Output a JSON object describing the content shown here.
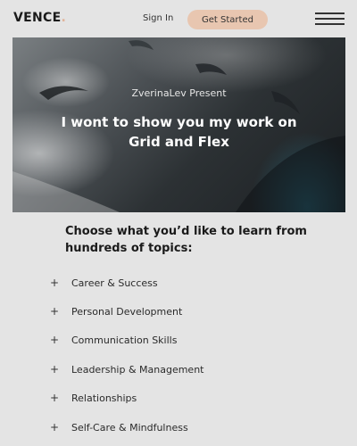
{
  "header": {
    "logo_text": "VENCE",
    "logo_dot": ".",
    "signin_label": "Sign In",
    "cta_label": "Get Started",
    "menu_icon": "hamburger-menu-icon"
  },
  "hero": {
    "subtitle": "ZverinaLev Present",
    "title": "I wont to show you my work on Grid and Flex"
  },
  "topics": {
    "heading": "Choose what you’d like to learn from hundreds of topics:",
    "items": [
      {
        "icon": "+",
        "label": "Career & Success"
      },
      {
        "icon": "+",
        "label": "Personal Development"
      },
      {
        "icon": "+",
        "label": "Communication Skills"
      },
      {
        "icon": "+",
        "label": "Leadership & Management"
      },
      {
        "icon": "+",
        "label": "Relationships"
      },
      {
        "icon": "+",
        "label": "Self-Care & Mindfulness"
      }
    ]
  },
  "colors": {
    "background": "#e4e4e4",
    "cta_background": "#e8c6b0",
    "text": "#1a1a1a"
  }
}
